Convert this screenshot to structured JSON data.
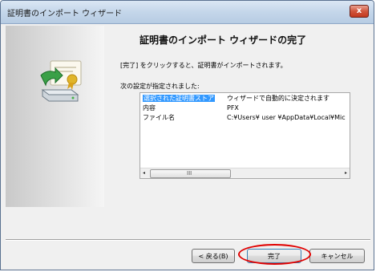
{
  "window": {
    "title": "証明書のインポート ウィザード",
    "close_glyph": "x"
  },
  "main": {
    "heading": "証明書のインポート ウィザードの完了",
    "description": "[完了] をクリックすると、証明書がインポートされます。",
    "settings_label": "次の設定が指定されました:",
    "rows": [
      {
        "label": "選択された証明書ストア",
        "value": "ウィザードで自動的に決定されます"
      },
      {
        "label": "内容",
        "value": "PFX"
      },
      {
        "label": "ファイル名",
        "value": "C:¥Users¥ user ¥AppData¥Local¥Mic"
      }
    ],
    "scroll_left": "◂",
    "scroll_right": "▸",
    "scroll_grip": "III"
  },
  "buttons": {
    "back": "< 戻る(B)",
    "finish": "完了",
    "cancel": "キャンセル"
  },
  "icons": {
    "side": "certificate-import-icon"
  },
  "colors": {
    "selection": "#3399ff",
    "highlight": "#e00000"
  }
}
